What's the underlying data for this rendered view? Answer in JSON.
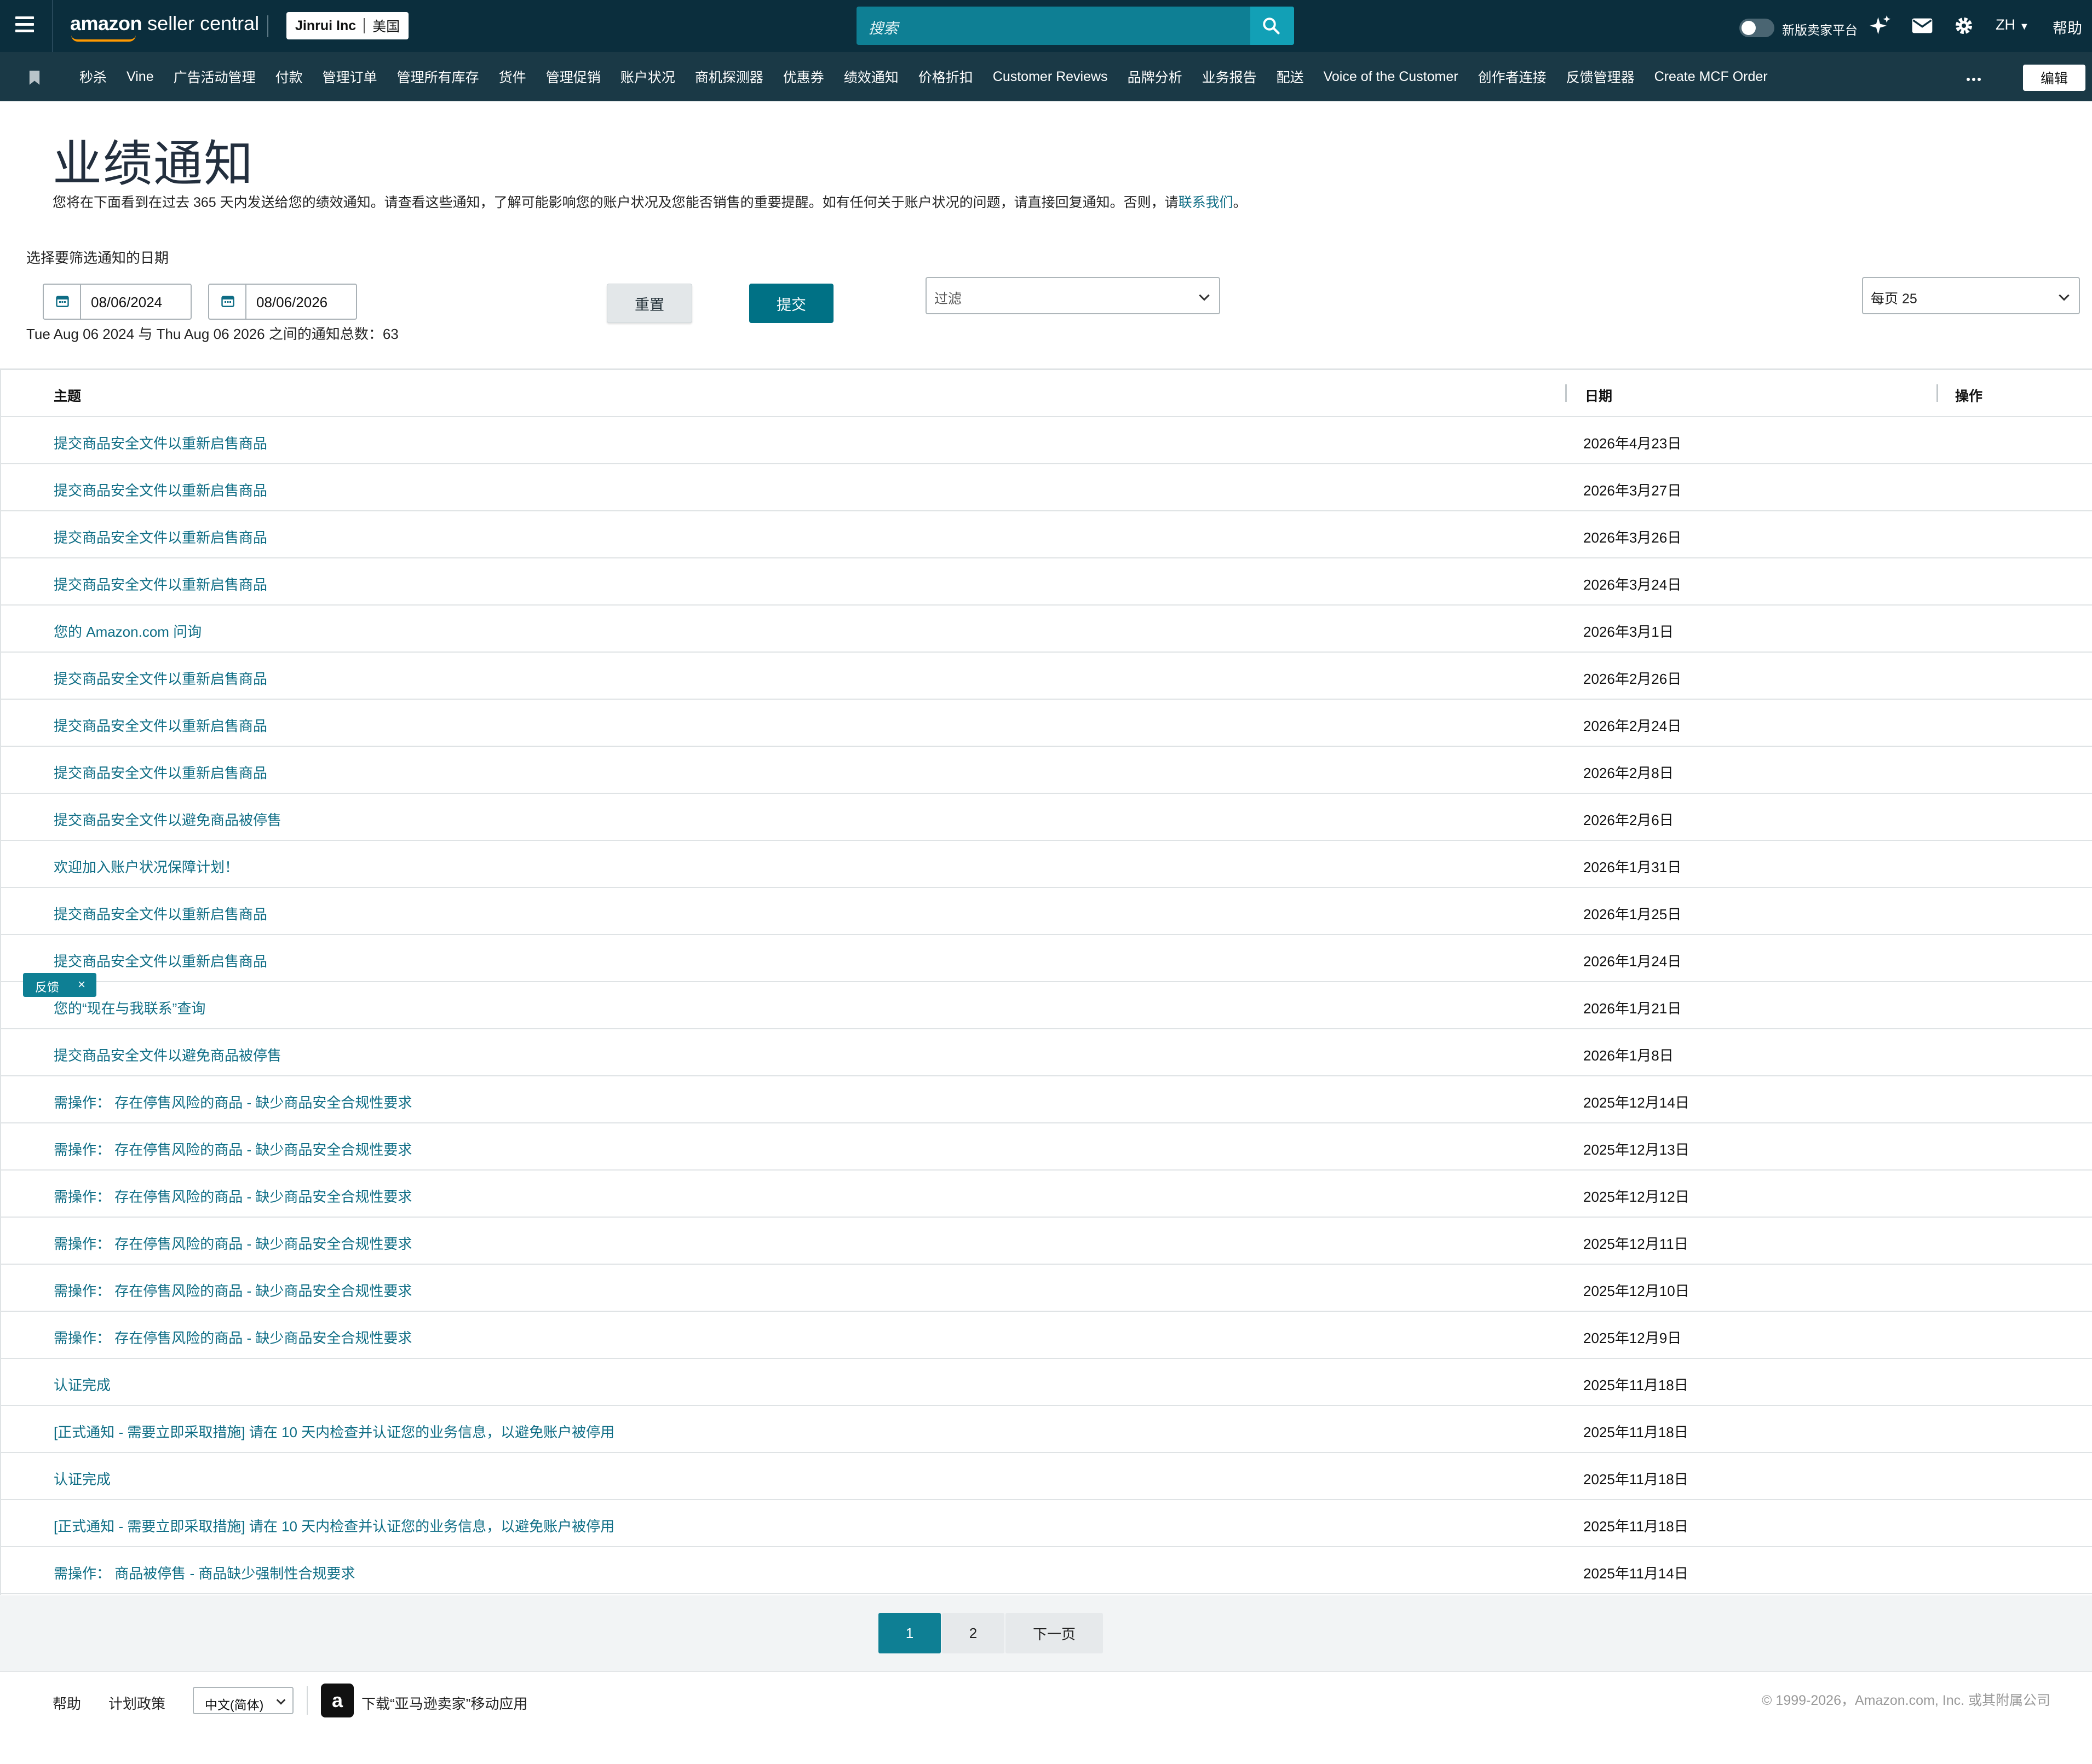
{
  "topbar": {
    "logo_amazon": "amazon",
    "logo_seller": "seller central",
    "account_name": "Jinrui Inc",
    "account_region": "美国",
    "search_placeholder": "搜索",
    "toggle_label": "新版卖家平台",
    "language": "ZH",
    "help": "帮助"
  },
  "nav": {
    "items": [
      "秒杀",
      "Vine",
      "广告活动管理",
      "付款",
      "管理订单",
      "管理所有库存",
      "货件",
      "管理促销",
      "账户状况",
      "商机探测器",
      "优惠券",
      "绩效通知",
      "价格折扣",
      "Customer Reviews",
      "品牌分析",
      "业务报告",
      "配送",
      "Voice of the Customer",
      "创作者连接",
      "反馈管理器",
      "Create MCF Order"
    ],
    "edit_label": "编辑"
  },
  "page": {
    "title": "业绩通知",
    "description": "您将在下面看到在过去 365 天内发送给您的绩效通知。请查看这些通知，了解可能影响您的账户状况及您能否销售的重要提醒。如有任何关于账户状况的问题，请直接回复通知。否则，请",
    "contact_link": "联系我们",
    "description_end": "。"
  },
  "filters": {
    "date_label": "选择要筛选通知的日期",
    "start_date": "08/06/2024",
    "end_date": "08/06/2026",
    "reset_label": "重置",
    "submit_label": "提交",
    "filter_placeholder": "过滤",
    "per_page": "每页 25",
    "summary": "Tue Aug 06 2024 与 Thu Aug 06 2026 之间的通知总数：63"
  },
  "table": {
    "headers": {
      "subject": "主题",
      "date": "日期",
      "action": "操作"
    },
    "rows": [
      {
        "subject": "提交商品安全文件以重新启售商品",
        "date": "2026年4月23日"
      },
      {
        "subject": "提交商品安全文件以重新启售商品",
        "date": "2026年3月27日"
      },
      {
        "subject": "提交商品安全文件以重新启售商品",
        "date": "2026年3月26日"
      },
      {
        "subject": "提交商品安全文件以重新启售商品",
        "date": "2026年3月24日"
      },
      {
        "subject": "您的 Amazon.com 问询",
        "date": "2026年3月1日"
      },
      {
        "subject": "提交商品安全文件以重新启售商品",
        "date": "2026年2月26日"
      },
      {
        "subject": "提交商品安全文件以重新启售商品",
        "date": "2026年2月24日"
      },
      {
        "subject": "提交商品安全文件以重新启售商品",
        "date": "2026年2月8日"
      },
      {
        "subject": "提交商品安全文件以避免商品被停售",
        "date": "2026年2月6日"
      },
      {
        "subject": "欢迎加入账户状况保障计划！",
        "date": "2026年1月31日"
      },
      {
        "subject": "提交商品安全文件以重新启售商品",
        "date": "2026年1月25日"
      },
      {
        "subject": "提交商品安全文件以重新启售商品",
        "date": "2026年1月24日"
      },
      {
        "subject": "您的“现在与我联系”查询",
        "date": "2026年1月21日"
      },
      {
        "subject": "提交商品安全文件以避免商品被停售",
        "date": "2026年1月8日"
      },
      {
        "subject": "需操作： 存在停售风险的商品 - 缺少商品安全合规性要求",
        "date": "2025年12月14日"
      },
      {
        "subject": "需操作： 存在停售风险的商品 - 缺少商品安全合规性要求",
        "date": "2025年12月13日"
      },
      {
        "subject": "需操作： 存在停售风险的商品 - 缺少商品安全合规性要求",
        "date": "2025年12月12日"
      },
      {
        "subject": "需操作： 存在停售风险的商品 - 缺少商品安全合规性要求",
        "date": "2025年12月11日"
      },
      {
        "subject": "需操作： 存在停售风险的商品 - 缺少商品安全合规性要求",
        "date": "2025年12月10日"
      },
      {
        "subject": "需操作： 存在停售风险的商品 - 缺少商品安全合规性要求",
        "date": "2025年12月9日"
      },
      {
        "subject": "认证完成",
        "date": "2025年11月18日"
      },
      {
        "subject": "[正式通知 - 需要立即采取措施] 请在 10 天内检查并认证您的业务信息，以避免账户被停用",
        "date": "2025年11月18日"
      },
      {
        "subject": "认证完成",
        "date": "2025年11月18日"
      },
      {
        "subject": "[正式通知 - 需要立即采取措施] 请在 10 天内检查并认证您的业务信息，以避免账户被停用",
        "date": "2025年11月18日"
      },
      {
        "subject": "需操作： 商品被停售 - 商品缺少强制性合规要求",
        "date": "2025年11月14日"
      }
    ]
  },
  "feedback": {
    "label": "反馈",
    "close": "×"
  },
  "pagination": {
    "page1": "1",
    "page2": "2",
    "next": "下一页"
  },
  "footer": {
    "help": "帮助",
    "policy": "计划政策",
    "language": "中文(简体)",
    "app_icon_letter": "a",
    "app_download": "下载“亚马逊卖家”移动应用",
    "copyright": "© 1999-2026，Amazon.com, Inc. 或其附属公司"
  },
  "colors": {
    "topbar": "#0b2e3d",
    "navbar": "#1a3946",
    "accent": "#007185",
    "link": "#0e6d85"
  }
}
